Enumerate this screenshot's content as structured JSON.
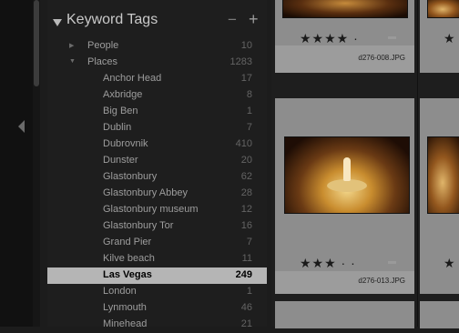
{
  "panel": {
    "title": "Keyword Tags",
    "minus": "−",
    "plus": "+"
  },
  "keywords": [
    {
      "name": "People",
      "count": "10",
      "level": 1,
      "expanded": false
    },
    {
      "name": "Places",
      "count": "1283",
      "level": 1,
      "expanded": true
    },
    {
      "name": "Anchor Head",
      "count": "17",
      "level": 2
    },
    {
      "name": "Axbridge",
      "count": "8",
      "level": 2
    },
    {
      "name": "Big Ben",
      "count": "1",
      "level": 2
    },
    {
      "name": "Dublin",
      "count": "7",
      "level": 2
    },
    {
      "name": "Dubrovnik",
      "count": "410",
      "level": 2
    },
    {
      "name": "Dunster",
      "count": "20",
      "level": 2
    },
    {
      "name": "Glastonbury",
      "count": "62",
      "level": 2
    },
    {
      "name": "Glastonbury Abbey",
      "count": "28",
      "level": 2
    },
    {
      "name": "Glastonbury museum",
      "count": "12",
      "level": 2
    },
    {
      "name": "Glastonbury Tor",
      "count": "16",
      "level": 2
    },
    {
      "name": "Grand Pier",
      "count": "7",
      "level": 2
    },
    {
      "name": "Kilve beach",
      "count": "11",
      "level": 2
    },
    {
      "name": "Las Vegas",
      "count": "249",
      "level": 2,
      "selected": true
    },
    {
      "name": "London",
      "count": "1",
      "level": 2
    },
    {
      "name": "Lynmouth",
      "count": "46",
      "level": 2
    },
    {
      "name": "Minehead",
      "count": "21",
      "level": 2
    }
  ],
  "grid": {
    "top_cell": {
      "stars": "★★★★ ·",
      "filename": "d276-008.JPG",
      "rating": 4
    },
    "mid_cell": {
      "stars": "★★★ · ·",
      "filename": "d276-013.JPG",
      "rating": 3
    },
    "partial_stars": "★"
  }
}
